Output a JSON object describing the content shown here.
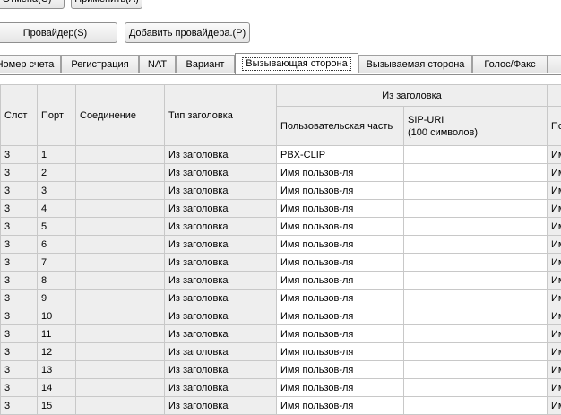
{
  "toolbar": {
    "cancel_label": "Отмена(С)",
    "apply_label": "Применить(А)",
    "provider_label": "Провайдер(S)",
    "add_provider_label": "Добавить провайдера.(P)"
  },
  "tabs": [
    {
      "label": "Номер счета",
      "active": false
    },
    {
      "label": "Регистрация",
      "active": false
    },
    {
      "label": "NAT",
      "active": false
    },
    {
      "label": "Вариант",
      "active": false
    },
    {
      "label": "Вызывающая сторона",
      "active": true
    },
    {
      "label": "Вызываемая сторона",
      "active": false
    },
    {
      "label": "Голос/Факс",
      "active": false
    }
  ],
  "table": {
    "headers": {
      "slot": "Слот",
      "port": "Порт",
      "connection": "Соединение",
      "header_type": "Тип заголовка",
      "from_header": "Из заголовка",
      "user_part": "Пользовательская часть",
      "sip_uri": "SIP-URI",
      "sip_uri_note": "(100 символов)",
      "last_col": "Пол"
    },
    "rows": [
      {
        "slot": "3",
        "port": "1",
        "connection": "",
        "header_type": "Из заголовка",
        "user_part": "PBX-CLIP",
        "sip_uri": "",
        "last": "Им"
      },
      {
        "slot": "3",
        "port": "2",
        "connection": "",
        "header_type": "Из заголовка",
        "user_part": "Имя пользов-ля",
        "sip_uri": "",
        "last": "Им"
      },
      {
        "slot": "3",
        "port": "3",
        "connection": "",
        "header_type": "Из заголовка",
        "user_part": "Имя пользов-ля",
        "sip_uri": "",
        "last": "Им"
      },
      {
        "slot": "3",
        "port": "4",
        "connection": "",
        "header_type": "Из заголовка",
        "user_part": "Имя пользов-ля",
        "sip_uri": "",
        "last": "Им"
      },
      {
        "slot": "3",
        "port": "5",
        "connection": "",
        "header_type": "Из заголовка",
        "user_part": "Имя пользов-ля",
        "sip_uri": "",
        "last": "Им"
      },
      {
        "slot": "3",
        "port": "6",
        "connection": "",
        "header_type": "Из заголовка",
        "user_part": "Имя пользов-ля",
        "sip_uri": "",
        "last": "Им"
      },
      {
        "slot": "3",
        "port": "7",
        "connection": "",
        "header_type": "Из заголовка",
        "user_part": "Имя пользов-ля",
        "sip_uri": "",
        "last": "Им"
      },
      {
        "slot": "3",
        "port": "8",
        "connection": "",
        "header_type": "Из заголовка",
        "user_part": "Имя пользов-ля",
        "sip_uri": "",
        "last": "Им"
      },
      {
        "slot": "3",
        "port": "9",
        "connection": "",
        "header_type": "Из заголовка",
        "user_part": "Имя пользов-ля",
        "sip_uri": "",
        "last": "Им"
      },
      {
        "slot": "3",
        "port": "10",
        "connection": "",
        "header_type": "Из заголовка",
        "user_part": "Имя пользов-ля",
        "sip_uri": "",
        "last": "Им"
      },
      {
        "slot": "3",
        "port": "11",
        "connection": "",
        "header_type": "Из заголовка",
        "user_part": "Имя пользов-ля",
        "sip_uri": "",
        "last": "Им"
      },
      {
        "slot": "3",
        "port": "12",
        "connection": "",
        "header_type": "Из заголовка",
        "user_part": "Имя пользов-ля",
        "sip_uri": "",
        "last": "Им"
      },
      {
        "slot": "3",
        "port": "13",
        "connection": "",
        "header_type": "Из заголовка",
        "user_part": "Имя пользов-ля",
        "sip_uri": "",
        "last": "Им"
      },
      {
        "slot": "3",
        "port": "14",
        "connection": "",
        "header_type": "Из заголовка",
        "user_part": "Имя пользов-ля",
        "sip_uri": "",
        "last": "Им"
      },
      {
        "slot": "3",
        "port": "15",
        "connection": "",
        "header_type": "Из заголовка",
        "user_part": "Имя пользов-ля",
        "sip_uri": "",
        "last": "Им"
      }
    ]
  }
}
